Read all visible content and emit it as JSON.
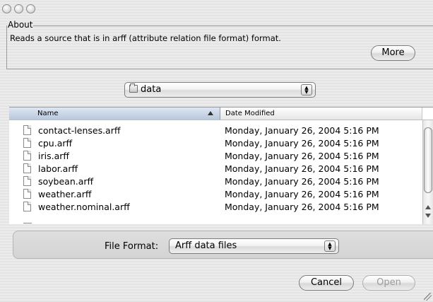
{
  "window": {
    "controls": [
      "close-icon",
      "minimize-icon",
      "zoom-icon"
    ]
  },
  "about": {
    "legend": "About",
    "description": "Reads a source that is in arff (attribute relation file format) format.",
    "more_label": "More"
  },
  "location": {
    "selected": "data"
  },
  "file_list": {
    "columns": {
      "name": "Name",
      "date": "Date Modified"
    },
    "rows": [
      {
        "name": "contact-lenses.arff",
        "date": "Monday, January 26, 2004 5:16 PM"
      },
      {
        "name": "cpu.arff",
        "date": "Monday, January 26, 2004 5:16 PM"
      },
      {
        "name": "iris.arff",
        "date": "Monday, January 26, 2004 5:16 PM"
      },
      {
        "name": "labor.arff",
        "date": "Monday, January 26, 2004 5:16 PM"
      },
      {
        "name": "soybean.arff",
        "date": "Monday, January 26, 2004 5:16 PM"
      },
      {
        "name": "weather.arff",
        "date": "Monday, January 26, 2004 5:16 PM"
      },
      {
        "name": "weather.nominal.arff",
        "date": "Monday, January 26, 2004 5:16 PM"
      }
    ]
  },
  "file_format": {
    "label": "File Format:",
    "selected": "Arff data files"
  },
  "actions": {
    "cancel_label": "Cancel",
    "open_label": "Open"
  }
}
